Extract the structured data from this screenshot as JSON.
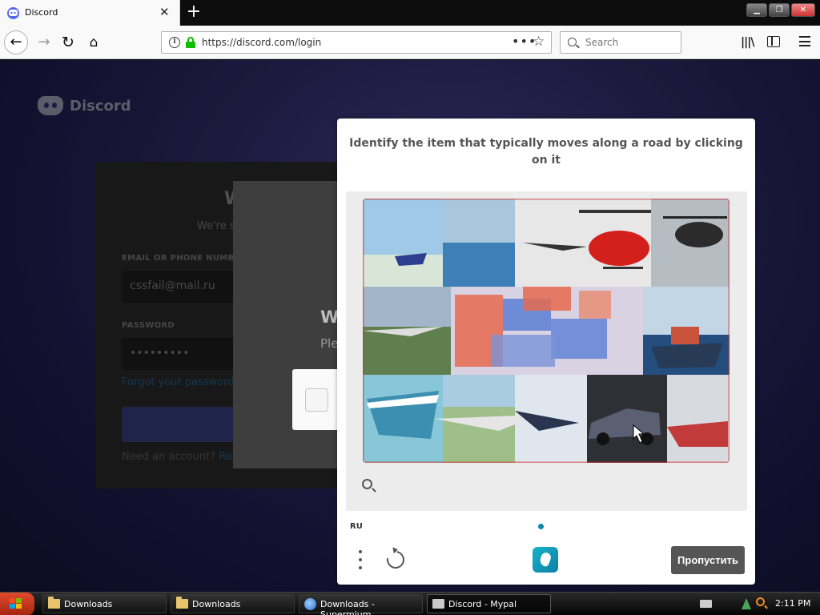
{
  "browser": {
    "tab_title": "Discord",
    "url": "https://discord.com/login",
    "search_placeholder": "Search",
    "new_tab": "+",
    "close_tab": "✕",
    "url_dots": "•••"
  },
  "discord": {
    "logo_text": "Discord",
    "login": {
      "title_partial": "W",
      "subtitle_partial": "We're s",
      "email_label": "EMAIL OR PHONE NUMB",
      "email_value": "cssfail@mail.ru",
      "password_label": "PASSWORD",
      "password_value": "•••••••••",
      "forgot": "Forgot your password?",
      "need_account": "Need an account?",
      "register_partial": "Regi"
    },
    "modal": {
      "title_partial": "W",
      "subtitle_partial": "Ple"
    }
  },
  "captcha": {
    "prompt": "Identify the item that typically moves along a road by clicking on it",
    "language": "RU",
    "skip_label": "Пропустить"
  },
  "taskbar": {
    "items": [
      {
        "label": "Downloads"
      },
      {
        "label": "Downloads"
      },
      {
        "label": "Downloads - Supermium"
      },
      {
        "label": "Discord - Mypal"
      }
    ],
    "clock": "2:11 PM"
  }
}
